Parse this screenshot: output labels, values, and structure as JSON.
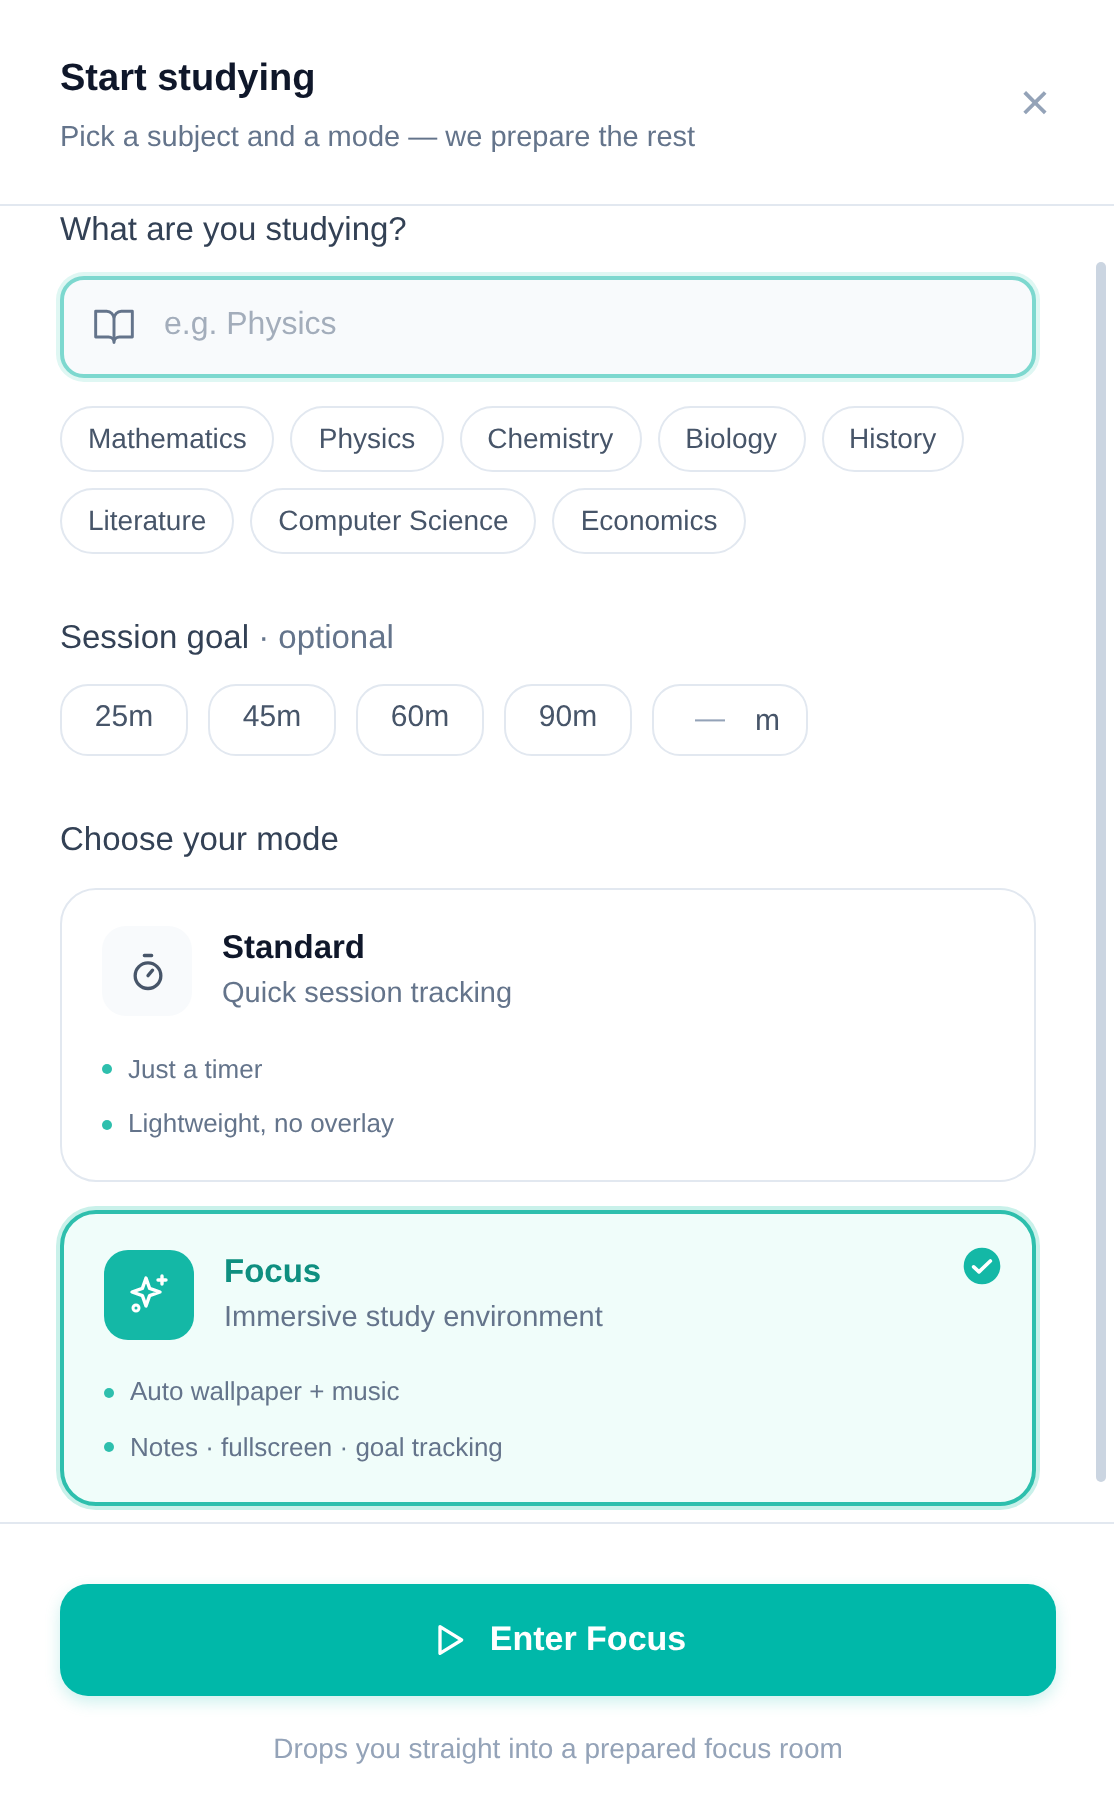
{
  "header": {
    "title": "Start studying",
    "subtitle": "Pick a subject and a mode — we prepare the rest",
    "close": "×"
  },
  "subject": {
    "label": "What are you studying?",
    "placeholder": "e.g. Physics",
    "suggestions": [
      "Mathematics",
      "Physics",
      "Chemistry",
      "Biology",
      "History",
      "Literature",
      "Computer Science",
      "Economics"
    ]
  },
  "goal": {
    "label": "Session goal",
    "hint": "· optional",
    "presets": [
      "25m",
      "45m",
      "60m",
      "90m"
    ],
    "custom": {
      "placeholder": "—",
      "unit": "m"
    }
  },
  "mode": {
    "label": "Choose your mode",
    "options": [
      {
        "title": "Standard",
        "subtitle": "Quick session tracking",
        "features": [
          "Just a timer",
          "Lightweight, no overlay"
        ],
        "selected": false
      },
      {
        "title": "Focus",
        "subtitle": "Immersive study environment",
        "features": [
          "Auto wallpaper + music",
          "Notes · fullscreen · goal tracking"
        ],
        "selected": true
      }
    ]
  },
  "footer": {
    "button": "Enter Focus",
    "note": "Drops you straight into a prepared focus room"
  }
}
